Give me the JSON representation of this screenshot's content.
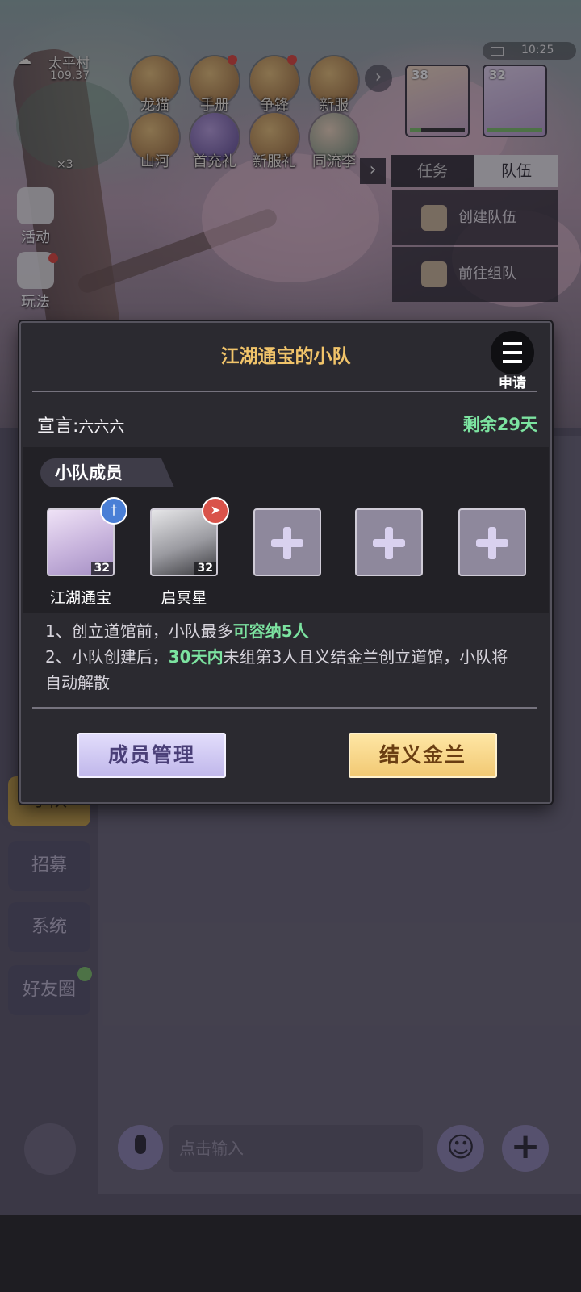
{
  "hud": {
    "location": "太平村",
    "coords": "109.37",
    "currency": "×3",
    "time": "10:25",
    "top_icons": [
      {
        "label": "龙猫",
        "icon": "cat-icon",
        "dot": false
      },
      {
        "label": "手册",
        "icon": "book-icon",
        "dot": true
      },
      {
        "label": "争锋",
        "icon": "banner-icon",
        "dot": true
      },
      {
        "label": "新服",
        "icon": "new-server-icon",
        "dot": false
      }
    ],
    "second_icons": [
      {
        "label": "山河",
        "icon": "bell-icon"
      },
      {
        "label": "首充礼",
        "icon": "gift-icon"
      },
      {
        "label": "新服礼",
        "icon": "chest-icon"
      },
      {
        "label": "同流李",
        "icon": "character-icon"
      }
    ],
    "portraits": [
      {
        "level": "38",
        "hp": 0.2
      },
      {
        "level": "32",
        "hp": 1.0
      }
    ],
    "side_buttons": [
      {
        "label": "活动",
        "icon": "gift-box-icon"
      },
      {
        "label": "玩法",
        "icon": "play-mode-icon"
      }
    ],
    "tabs": {
      "task": "任务",
      "team": "队伍"
    },
    "team_actions": [
      {
        "label": "创建队伍",
        "icon": "flag-icon"
      },
      {
        "label": "前往组队",
        "icon": "user-add-icon"
      }
    ]
  },
  "channels": [
    {
      "label": "小队",
      "active": true
    },
    {
      "label": "招募",
      "active": false
    },
    {
      "label": "系统",
      "active": false
    },
    {
      "label": "好友圈",
      "active": false
    }
  ],
  "chat": {
    "input_placeholder": "点击输入"
  },
  "dialog": {
    "title": "江湖通宝的小队",
    "apply_label": "申请",
    "declaration_label": "宣言:",
    "declaration_text": "六六六",
    "remaining": "剩余29天",
    "members_title": "小队成员",
    "members": [
      {
        "name": "江湖通宝",
        "level": "32",
        "badge": "sword-badge-icon",
        "badge_color": "#4a7fd6"
      },
      {
        "name": "启冥星",
        "level": "32",
        "badge": "plane-badge-icon",
        "badge_color": "#d9534a"
      }
    ],
    "empty_slots": 3,
    "note1_prefix": "1、创立道馆前，小队最多",
    "note1_highlight": "可容纳5人",
    "note2_prefix": "2、小队创建后，",
    "note2_highlight": "30天内",
    "note2_suffix": "未组第3人且义结金兰创立道馆，小队将",
    "note2_line2": "自动解散",
    "btn_manage": "成员管理",
    "btn_sworn": "结义金兰"
  },
  "colors": {
    "title_gold": "#f1c46a",
    "highlight_green": "#7ce3a0",
    "dialog_bg": "#2b2a30"
  }
}
